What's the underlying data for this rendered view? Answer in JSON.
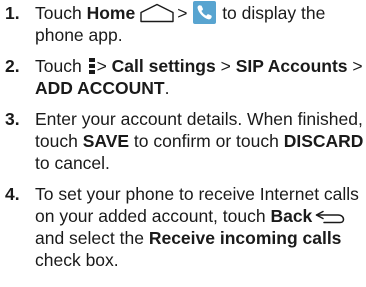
{
  "steps": [
    {
      "number": "1.",
      "t1": "Touch",
      "home": "Home",
      "t2": ">",
      "t3": "to display the phone app."
    },
    {
      "number": "2.",
      "t1": "Touch",
      "t2": "> ",
      "call_settings": "Call settings",
      "t3": " > ",
      "sip_accounts": "SIP Accounts",
      "t4": " > ",
      "add_account": "ADD ACCOUNT",
      "t5": "."
    },
    {
      "number": "3.",
      "t1": "Enter your account details. When finished, touch ",
      "save": "SAVE",
      "t2": " to confirm or touch ",
      "discard": "DISCARD",
      "t3": " to cancel."
    },
    {
      "number": "4.",
      "t1": "To set your phone to receive Internet calls on your added account, touch ",
      "back": "Back",
      "t2": " and select the ",
      "receive": "Receive incoming calls",
      "t3": " check box."
    }
  ],
  "icons": {
    "home": "home-icon",
    "phone": "phone-app-icon",
    "menu": "menu-icon",
    "back": "back-icon"
  },
  "colors": {
    "text": "#1a1a1a",
    "phone_icon_bg": "#58a4d0"
  }
}
